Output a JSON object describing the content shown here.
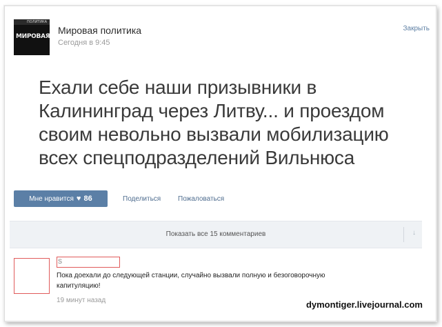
{
  "post": {
    "group_name": "Мировая политика",
    "avatar_logo_text": "МИРОВАЯ",
    "avatar_tiny_text": "ПОЛИТИКА",
    "time": "Сегодня в 9:45",
    "close_label": "Закрыть",
    "text": "Ехали себе наши призывники в Калининград через Литву... и проездом своим невольно вызвали мобилизацию всех спецподразделений Вильнюса"
  },
  "actions": {
    "like_label": "Мне нравится",
    "like_icon": "heart-icon",
    "like_count": "86",
    "share_label": "Поделиться",
    "report_label": "Пожаловаться",
    "accent_color": "#5b7fa6"
  },
  "comments": {
    "show_all_label": "Показать все 15 комментариев",
    "collapse_icon": "arrow-down-icon",
    "items": [
      {
        "author_initial": "S",
        "text": "Пока доехали до следующей станции, случайно вызвали полную и безоговорочную капитуляцию!",
        "time": "19 минут назад"
      }
    ]
  },
  "watermark": "dymontiger.livejournal.com"
}
